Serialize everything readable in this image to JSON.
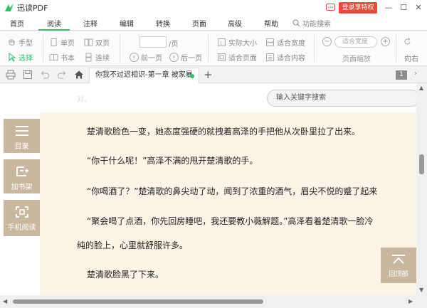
{
  "title_bar": {
    "app_title": "迅读PDF",
    "login_label": "登录享特权",
    "min": "—",
    "max": "☐",
    "close": "✕"
  },
  "menu": [
    {
      "label": "首页"
    },
    {
      "label": "阅读"
    },
    {
      "label": "注释"
    },
    {
      "label": "编辑"
    },
    {
      "label": "转换"
    },
    {
      "label": "页面"
    },
    {
      "label": "高级"
    },
    {
      "label": "帮助"
    }
  ],
  "function_search": {
    "placeholder": "功能搜索"
  },
  "ribbon": {
    "hand": "手型",
    "select": "选择",
    "single": "单页",
    "double": "双页",
    "book": "书本",
    "continuous": "连续",
    "page_suffix": "/页",
    "prev": "前一页",
    "next": "后一页",
    "actual_size": "实际大小",
    "fit_width": "适合宽度",
    "fit_page": "适合页面",
    "fit_content": "适合内容",
    "zoom_value": "适合宽度",
    "zoom_label": "页面缩放",
    "rotate_left": "向右"
  },
  "tab": {
    "document_title": "你我不过迟相识-第一章 被家暴",
    "page_number": "1"
  },
  "search": {
    "placeholder": "输入关键字搜索"
  },
  "faded_text": "对。",
  "side_buttons": {
    "toc": "目录",
    "bookshelf": "加书架",
    "mobile": "手机阅读"
  },
  "back_to_top": "回顶部",
  "paragraphs": [
    "楚清歌脸色一变，她态度强硬的就拽着高泽的手把他从次卧里拉了出来。",
    "“你干什么呢！”高泽不满的甩开楚清歌的手。",
    "“你喝酒了？”楚清歌的鼻尖动了动，闻到了浓重的酒气，眉尖不悦的蹙了起来",
    "“聚会喝了点酒，你先回房睡吧，我还要教小薇解题。”高泽看着楚清歌一脸冷",
    "纯的脸上，心里就舒服许多。",
    "楚清歌脸黑了下来。"
  ],
  "colors": {
    "accent": "#2dbe6c",
    "login": "#e84a3c",
    "side": "#c9b89f",
    "page_bg": "#fdf4e8"
  }
}
